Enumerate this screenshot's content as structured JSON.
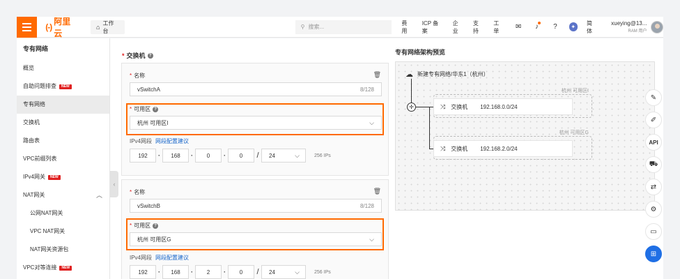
{
  "header": {
    "logo_text": "阿里云",
    "logo_mark": "(-)",
    "workbench": "工作台",
    "search_placeholder": "搜索...",
    "nav": [
      "费用",
      "ICP 备案",
      "企业",
      "支持",
      "工单"
    ],
    "lang": "简体",
    "user_name": "xueying@13...",
    "user_role": "RAM 用户"
  },
  "sidebar": {
    "title": "专有网络",
    "items": [
      {
        "label": "概览"
      },
      {
        "label": "自助问题排查",
        "badge": "NEW"
      },
      {
        "label": "专有网络",
        "active": true
      },
      {
        "label": "交换机"
      },
      {
        "label": "路由表"
      },
      {
        "label": "VPC前缀列表"
      },
      {
        "label": "IPv4网关",
        "badge": "NEW"
      },
      {
        "label": "NAT网关",
        "expanded": true
      },
      {
        "label": "公网NAT网关",
        "sub": true
      },
      {
        "label": "VPC NAT网关",
        "sub": true
      },
      {
        "label": "NAT网关资源包",
        "sub": true
      },
      {
        "label": "VPC对等连接",
        "badge": "NEW"
      }
    ]
  },
  "form": {
    "section_title": "交换机",
    "name_label": "名称",
    "zone_label": "可用区",
    "ipv4_label": "IPv4网段",
    "ipv4_link": "网段配置建议",
    "switches": [
      {
        "name": "vSwitchA",
        "count": "8/128",
        "zone": "杭州 可用区I",
        "octets": [
          "192",
          "168",
          "0",
          "0"
        ],
        "mask": "24",
        "ips": "256 IPs"
      },
      {
        "name": "vSwitchB",
        "count": "8/128",
        "zone": "杭州 可用区G",
        "octets": [
          "192",
          "168",
          "2",
          "0"
        ],
        "mask": "24",
        "ips": "256 IPs"
      }
    ]
  },
  "preview": {
    "title": "专有网络架构预览",
    "vpc_name": "新建专有网络/华东1（杭州）",
    "zones": [
      {
        "zone": "杭州 可用区I",
        "switch_label": "交换机",
        "cidr": "192.168.0.0/24"
      },
      {
        "zone": "杭州 可用区G",
        "switch_label": "交换机",
        "cidr": "192.168.2.0/24"
      }
    ]
  },
  "rail": {
    "api_label": "API"
  }
}
